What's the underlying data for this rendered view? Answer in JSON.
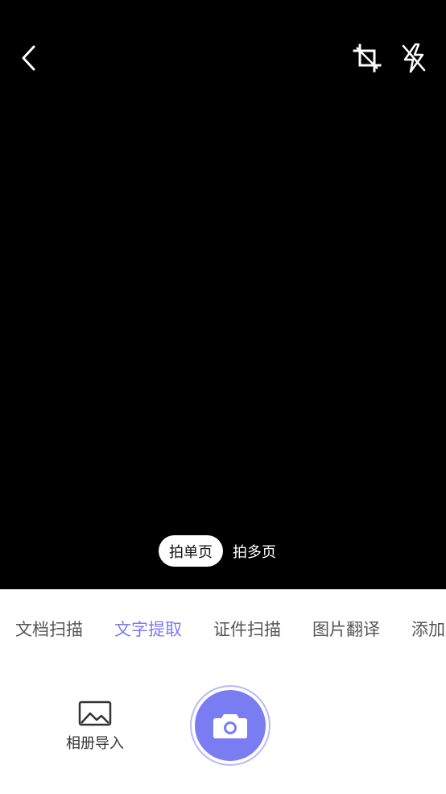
{
  "capture_modes": {
    "active": "拍单页",
    "inactive": "拍多页"
  },
  "tabs": [
    {
      "label": "文档扫描",
      "active": false
    },
    {
      "label": "文字提取",
      "active": true
    },
    {
      "label": "证件扫描",
      "active": false
    },
    {
      "label": "图片翻译",
      "active": false
    },
    {
      "label": "添加",
      "active": false
    }
  ],
  "gallery": {
    "label": "相册导入"
  },
  "icons": {
    "back": "chevron-left-icon",
    "crop": "crop-icon",
    "flash": "flash-off-icon",
    "gallery": "image-icon",
    "shutter": "camera-icon"
  },
  "colors": {
    "accent": "#7a7cf2",
    "viewfinder": "#000000"
  }
}
